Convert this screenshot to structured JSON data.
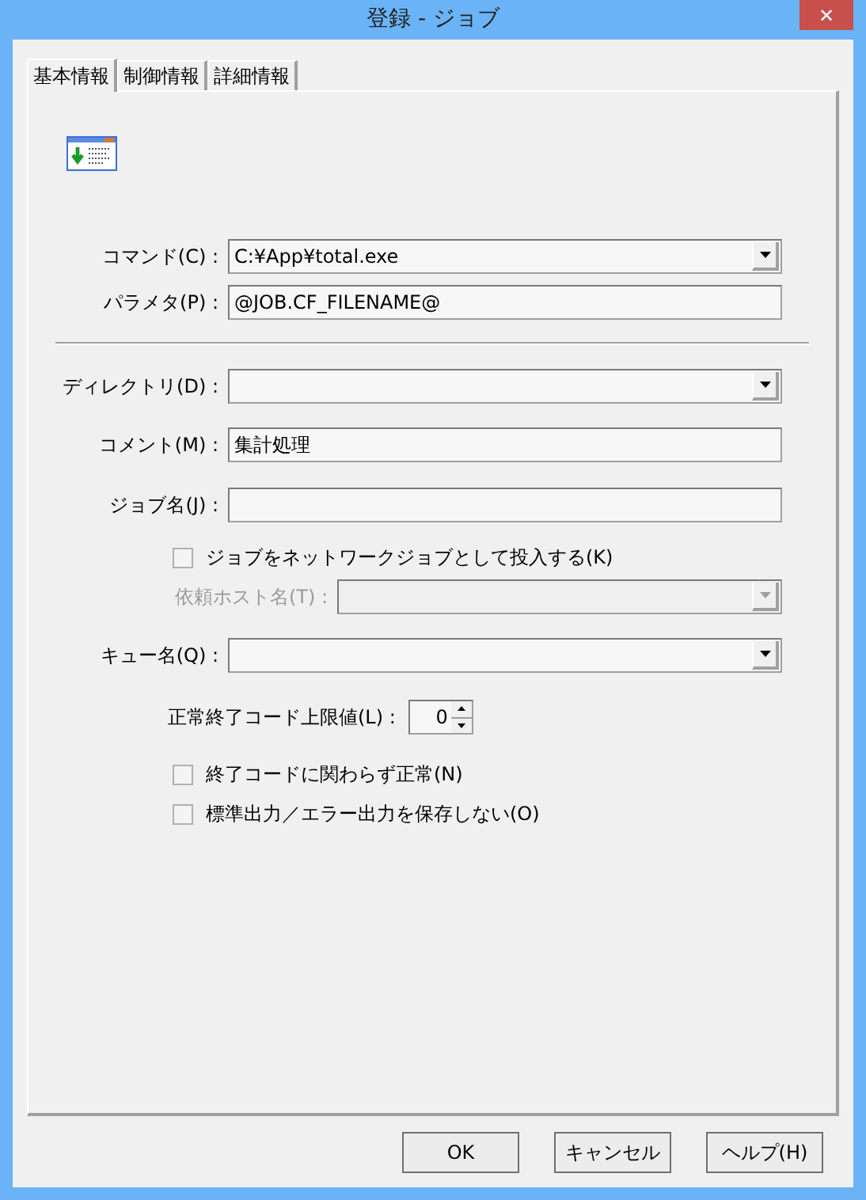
{
  "window": {
    "title": "登録 - ジョブ",
    "close": "✕"
  },
  "tabs": [
    {
      "label": "基本情報",
      "selected": true
    },
    {
      "label": "制御情報",
      "selected": false
    },
    {
      "label": "詳細情報",
      "selected": false
    }
  ],
  "sections": [
    {
      "fields": [
        {
          "kind": "combo",
          "label": "コマンド(C) :",
          "value": "C:¥App¥total.exe"
        },
        {
          "kind": "text",
          "label": "パラメタ(P) :",
          "value": "@JOB.CF_FILENAME@"
        }
      ]
    },
    {
      "fields": [
        {
          "kind": "combo",
          "label": "ディレクトリ(D) :"
        },
        {
          "kind": "text",
          "label": "コメント(M) :",
          "value": "集計処理"
        },
        {
          "kind": "text",
          "label": "ジョブ名(J) :"
        },
        {
          "kind": "checkbox",
          "label": "ジョブをネットワークジョブとして投入する(K)",
          "checked": false
        },
        {
          "kind": "combo",
          "label": "依頼ホスト名(T) :",
          "disabled": true
        },
        {
          "kind": "combo",
          "label": "キュー名(Q) :"
        },
        {
          "kind": "spinner",
          "label": "正常終了コード上限値(L) :",
          "value": "0"
        },
        {
          "kind": "checkbox",
          "label": "終了コードに関わらず正常(N)",
          "checked": false
        },
        {
          "kind": "checkbox",
          "label": "標準出力／エラー出力を保存しない(O)",
          "checked": false
        }
      ]
    }
  ],
  "buttons": [
    "OK",
    "キャンセル",
    "ヘルプ(H)"
  ]
}
